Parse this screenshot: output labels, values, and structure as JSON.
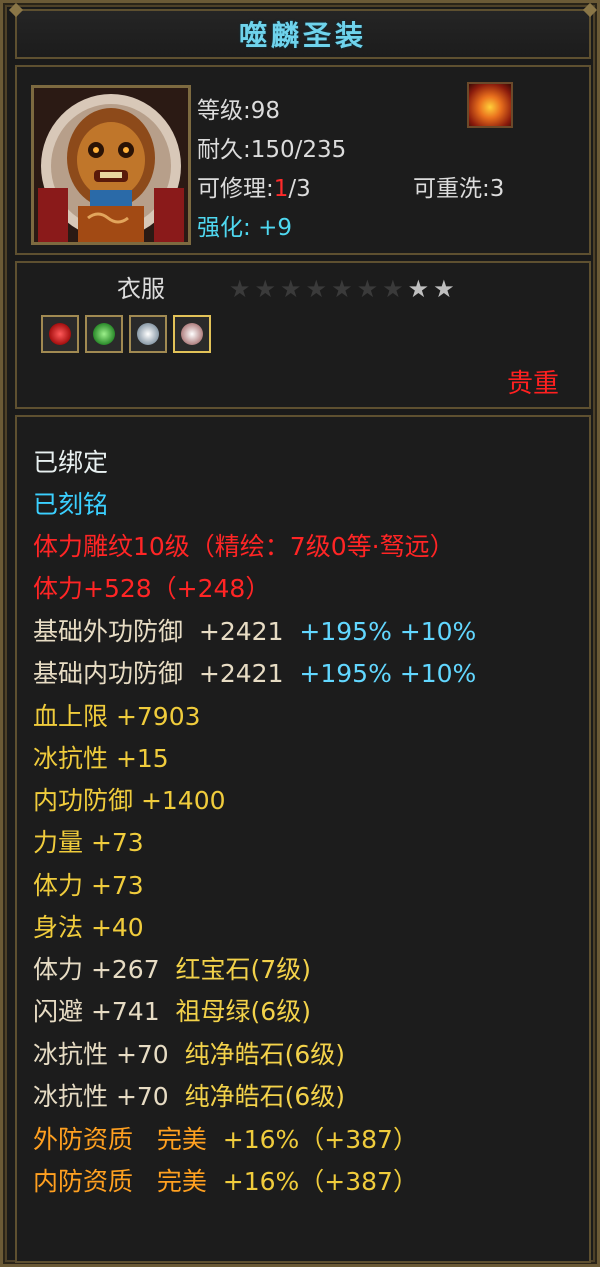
{
  "title": "噬麟圣装",
  "item": {
    "level_label": "等级",
    "level_value": "98",
    "durability_label": "耐久",
    "durability_value": "150/235",
    "repair_label": "可修理",
    "repair_current": "1",
    "repair_max": "/3",
    "reroll_label": "可重洗",
    "reroll_value": "3",
    "enhance_label": "强化",
    "enhance_value": "+9",
    "portrait_icon": "golden-mask-armor-icon",
    "type_icon": "fire-emblem-icon"
  },
  "slot": {
    "label": "衣服",
    "stars_filled": 7,
    "stars_total": 9,
    "gems": [
      "ruby-gem-icon",
      "emerald-gem-icon",
      "pure-diamond-gem-icon",
      "pure-diamond-gem-icon"
    ],
    "rarity": "贵重"
  },
  "colors": {
    "title": "#6fd3ec",
    "enhance": "#4fd8f0",
    "rarity": "#ff2020",
    "star_filled": "#3a3a3a",
    "star_empty": "#bfbfbf"
  },
  "attributes": {
    "bound": "已绑定",
    "engraved": "已刻铭",
    "carving": "体力雕纹10级（精绘：7级0等·驽远）",
    "stamina_carving": "体力+528（+248）",
    "ext_def_label": "基础外功防御",
    "ext_def_value": "+2421",
    "ext_def_pct": "+195%",
    "ext_def_extra": "+10%",
    "int_def_label": "基础内功防御",
    "int_def_value": "+2421",
    "int_def_pct": "+195%",
    "int_def_extra": "+10%",
    "hp": "血上限 +7903",
    "ice_res": "冰抗性 +15",
    "inner_def": "内功防御 +1400",
    "strength": "力量 +73",
    "stamina": "体力 +73",
    "agility": "身法 +40",
    "gem1_stat": "体力 +267",
    "gem1_name": "红宝石(7级)",
    "gem2_stat": "闪避 +741",
    "gem2_name": "祖母绿(6级)",
    "gem3_stat": "冰抗性 +70",
    "gem3_name": "纯净皓石(6级)",
    "gem4_stat": "冰抗性 +70",
    "gem4_name": "纯净皓石(6级)",
    "q1_label": "外防资质",
    "q1_grade": "完美",
    "q1_value": "+16%（+387）",
    "q2_label": "内防资质",
    "q2_grade": "完美",
    "q2_value": "+16%（+387）"
  }
}
